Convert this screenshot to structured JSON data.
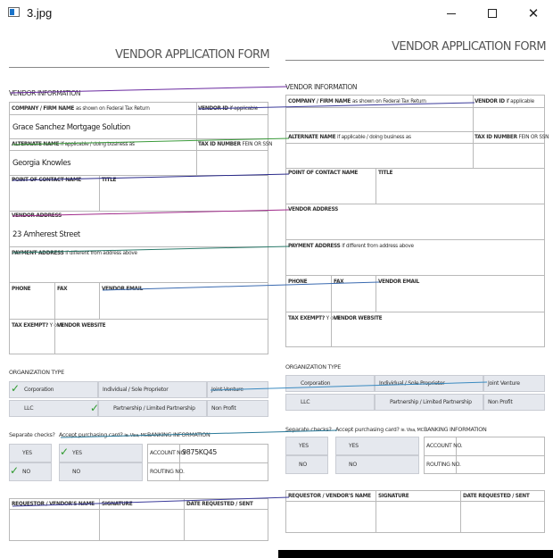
{
  "window": {
    "title": "3.jpg"
  },
  "form": {
    "title": "VENDOR APPLICATION FORM",
    "vendor_info_heading": "VENDOR INFORMATION",
    "labels": {
      "company_name": "COMPANY / FIRM NAME",
      "company_name_note": "as shown on Federal Tax Return",
      "vendor_id": "VENDOR ID",
      "vendor_id_note": "if applicable",
      "alternate_name": "ALTERNATE NAME",
      "alternate_name_note": "if applicable / doing business as",
      "tax_id": "TAX ID NUMBER",
      "tax_id_note": "FEIN OR SSN",
      "point_of_contact": "POINT OF CONTACT NAME",
      "title_field": "TITLE",
      "vendor_address": "VENDOR ADDRESS",
      "payment_address": "PAYMENT ADDRESS",
      "payment_address_note": "if different from address above",
      "phone": "PHONE",
      "fax": "FAX",
      "vendor_email": "VENDOR EMAIL",
      "tax_exempt": "TAX EXEMPT?",
      "tax_exempt_note": "Y or N",
      "vendor_website": "VENDOR WEBSITE"
    },
    "org_heading": "ORGANIZATION TYPE",
    "org_options": [
      "Corporation",
      "Individual / Sole Proprietor",
      "Joint Venture",
      "LLC",
      "Partnership / Limited Partnership",
      "Non Profit"
    ],
    "separate_checks_label": "Separate checks?",
    "accept_cards_label": "Accept purchasing card?",
    "accept_cards_note": "ie. Visa, MC",
    "banking_heading": "BANKING INFORMATION",
    "yes": "YES",
    "no": "NO",
    "account_no": "ACCOUNT NO.",
    "routing_no": "ROUTING NO.",
    "requestor": "REQUESTOR / VENDOR'S NAME",
    "signature": "SIGNATURE",
    "date_requested": "DATE REQUESTED / SENT"
  },
  "filled_values": {
    "company_name": "Grace Sanchez Mortgage Solution",
    "alternate_name": "Georgia Knowles",
    "vendor_address": "23 Amherest Street",
    "account_no": "9875KQ45"
  },
  "checks": {
    "left_form": [
      "Corporation",
      "Partnership / Limited Partnership",
      "Separate checks: NO",
      "Accept purchasing card: YES"
    ]
  },
  "colors": {
    "check": "#2e9a2e",
    "option_fill": "#e5e8ee",
    "link_line": "#3a3a9a"
  }
}
